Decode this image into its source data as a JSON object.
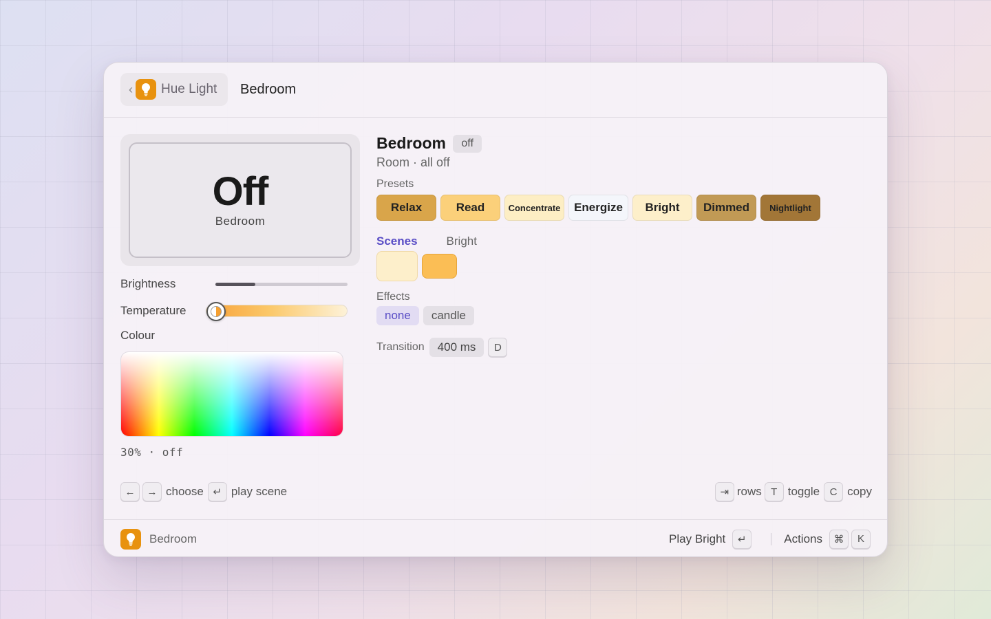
{
  "header": {
    "back_label": "Hue Light",
    "title": "Bedroom",
    "back_icon": "chevron-left-icon",
    "app_icon": "lightbulb-icon"
  },
  "status_card": {
    "state": "Off",
    "room": "Bedroom"
  },
  "controls": {
    "brightness_label": "Brightness",
    "brightness_value": 0.3,
    "temperature_label": "Temperature",
    "temperature_value": 0.0,
    "colour_label": "Colour",
    "summary": "30% · off"
  },
  "room": {
    "title": "Bedroom",
    "state": "off",
    "subtitle": "Room · all off"
  },
  "presets": {
    "label": "Presets",
    "items": [
      {
        "label": "Relax",
        "color": "#d9a54a"
      },
      {
        "label": "Read",
        "color": "#fbd07a"
      },
      {
        "label": "Concentrate",
        "color": "#fdeec4"
      },
      {
        "label": "Energize",
        "color": "#f4f6fb"
      },
      {
        "label": "Bright",
        "color": "#fdefca"
      },
      {
        "label": "Dimmed",
        "color": "#c19a55"
      },
      {
        "label": "Nightlight",
        "color": "#a27637"
      }
    ]
  },
  "scenes": {
    "label": "Scenes",
    "active": "Bright",
    "swatches": [
      "#fdefcb",
      "#fbbe55"
    ]
  },
  "effects": {
    "label": "Effects",
    "items": [
      {
        "label": "none",
        "selected": true
      },
      {
        "label": "candle",
        "selected": false
      }
    ]
  },
  "transition": {
    "label": "Transition",
    "value": "400 ms",
    "key": "D"
  },
  "hints": {
    "left_key": "←",
    "right_key": "→",
    "choose": "choose",
    "enter_key": "↵",
    "play_scene": "play scene",
    "tab_key": "⇥",
    "rows": "rows",
    "t_key": "T",
    "toggle": "toggle",
    "c_key": "C",
    "copy": "copy"
  },
  "footer": {
    "name": "Bedroom",
    "primary_action": "Play Bright",
    "enter_key": "↵",
    "actions": "Actions",
    "cmd_key": "⌘",
    "k_key": "K"
  },
  "colors": {
    "accent": "#5a4ec6",
    "app_icon": "#e8920f"
  }
}
